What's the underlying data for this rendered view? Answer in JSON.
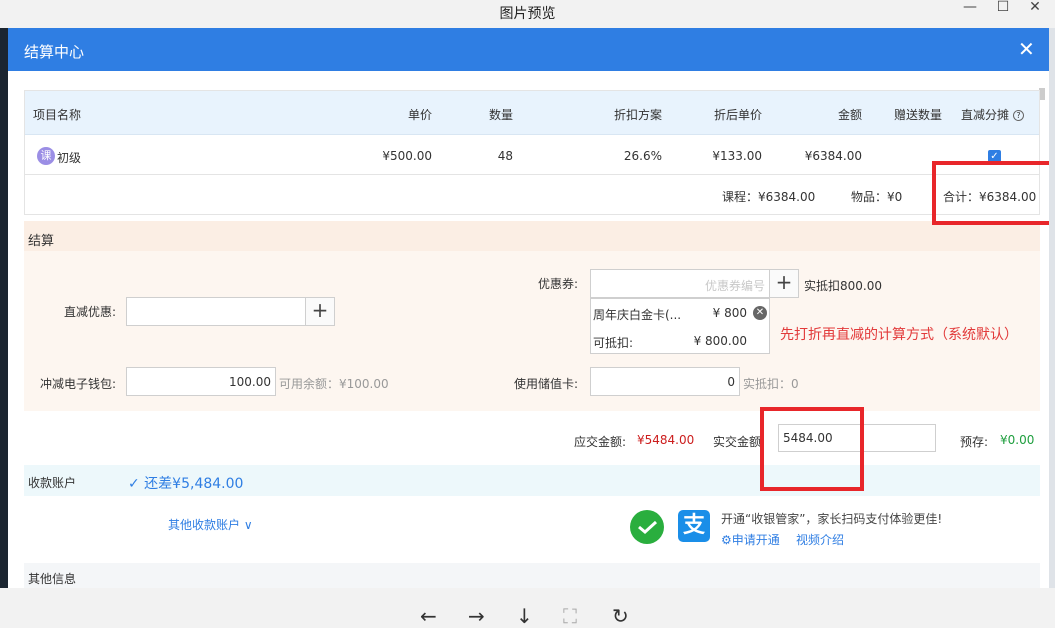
{
  "viewer": {
    "title": "图片预览",
    "minimize": "—",
    "maximize": "☐",
    "close": "✕",
    "toolbar": [
      "←",
      "→",
      "↓",
      "⛶",
      "↻"
    ]
  },
  "dialog": {
    "title": "结算中心",
    "close": "✕"
  },
  "table": {
    "headers": {
      "name": "项目名称",
      "price": "单价",
      "qty": "数量",
      "discount": "折扣方案",
      "disc_price": "折后单价",
      "amount": "金额",
      "gift_qty": "赠送数量",
      "direct_share": "直减分摊"
    },
    "help_icon": "?",
    "rows": [
      {
        "tag": "课",
        "name": "初级",
        "price": "¥500.00",
        "qty": "48",
        "discount": "26.6%",
        "disc_price": "¥133.00",
        "amount": "¥6384.00",
        "gift_qty": "",
        "checked": "✓"
      }
    ],
    "summary": {
      "course": "课程：¥6384.00",
      "goods": "物品：¥0",
      "total": "合计：¥6384.00"
    }
  },
  "settle": {
    "title": "结算",
    "direct_label": "直减优惠:",
    "direct_value": "",
    "coupon_label": "优惠券:",
    "coupon_placeholder": "优惠券编号",
    "coupon_actual": "实抵扣800.00",
    "coupon_card": {
      "name": "周年庆白金卡(...",
      "value": "¥ 800",
      "deduct_label": "可抵扣:",
      "deduct_value": "¥ 800.00"
    },
    "wallet_label": "冲减电子钱包:",
    "wallet_value": "100.00",
    "wallet_balance": "可用余额：¥100.00",
    "stored_label": "使用储值卡:",
    "stored_value": "0",
    "stored_actual": "实抵扣：0",
    "plus": "+",
    "note": "先打折再直减的计算方式（系统默认）"
  },
  "payment": {
    "due_label": "应交金额:",
    "due_value": "¥5484.00",
    "actual_label": "实交金额",
    "actual_value": "5484.00",
    "prestore_label": "预存:",
    "prestore_value": "¥0.00"
  },
  "account": {
    "label": "收款账户",
    "remaining": "✓ 还差¥5,484.00",
    "other_accounts": "其他收款账户 ∨",
    "promo": "开通“收银管家”，家长扫码支付体验更佳!",
    "apply": "申请开通",
    "video": "视频介绍",
    "alipay_glyph": "支"
  },
  "other_info": {
    "title": "其他信息"
  },
  "colors": {
    "accent": "#2f7ee3",
    "due_red": "#cc1d1d",
    "prestore_green": "#1e9e3e",
    "highlight_red": "#e8262a"
  }
}
